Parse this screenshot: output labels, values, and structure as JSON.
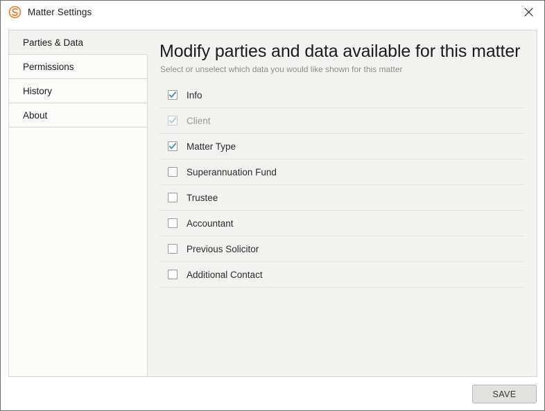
{
  "window": {
    "title": "Matter Settings",
    "logo_icon": "swirl-logo-icon",
    "logo_color": "#ee7623",
    "close_icon": "close-icon"
  },
  "sidebar": {
    "items": [
      {
        "label": "Parties & Data",
        "selected": true
      },
      {
        "label": "Permissions",
        "selected": false
      },
      {
        "label": "History",
        "selected": false
      },
      {
        "label": "About",
        "selected": false
      }
    ]
  },
  "content": {
    "heading": "Modify parties and data available for this matter",
    "subheading": "Select or unselect which data you would like shown for this matter",
    "options": [
      {
        "label": "Info",
        "checked": true,
        "disabled": false
      },
      {
        "label": "Client",
        "checked": true,
        "disabled": true
      },
      {
        "label": "Matter Type",
        "checked": true,
        "disabled": false
      },
      {
        "label": "Superannuation Fund",
        "checked": false,
        "disabled": false
      },
      {
        "label": "Trustee",
        "checked": false,
        "disabled": false
      },
      {
        "label": "Accountant",
        "checked": false,
        "disabled": false
      },
      {
        "label": "Previous Solicitor",
        "checked": false,
        "disabled": false
      },
      {
        "label": "Additional Contact",
        "checked": false,
        "disabled": false
      }
    ]
  },
  "footer": {
    "save_label": "SAVE"
  },
  "colors": {
    "accent_orange": "#ee7623",
    "check_blue": "#4a86c8",
    "check_blue_disabled": "#a8c6e4",
    "panel_bg": "#f2f2f0",
    "sidebar_bg": "#fbfbfa"
  }
}
